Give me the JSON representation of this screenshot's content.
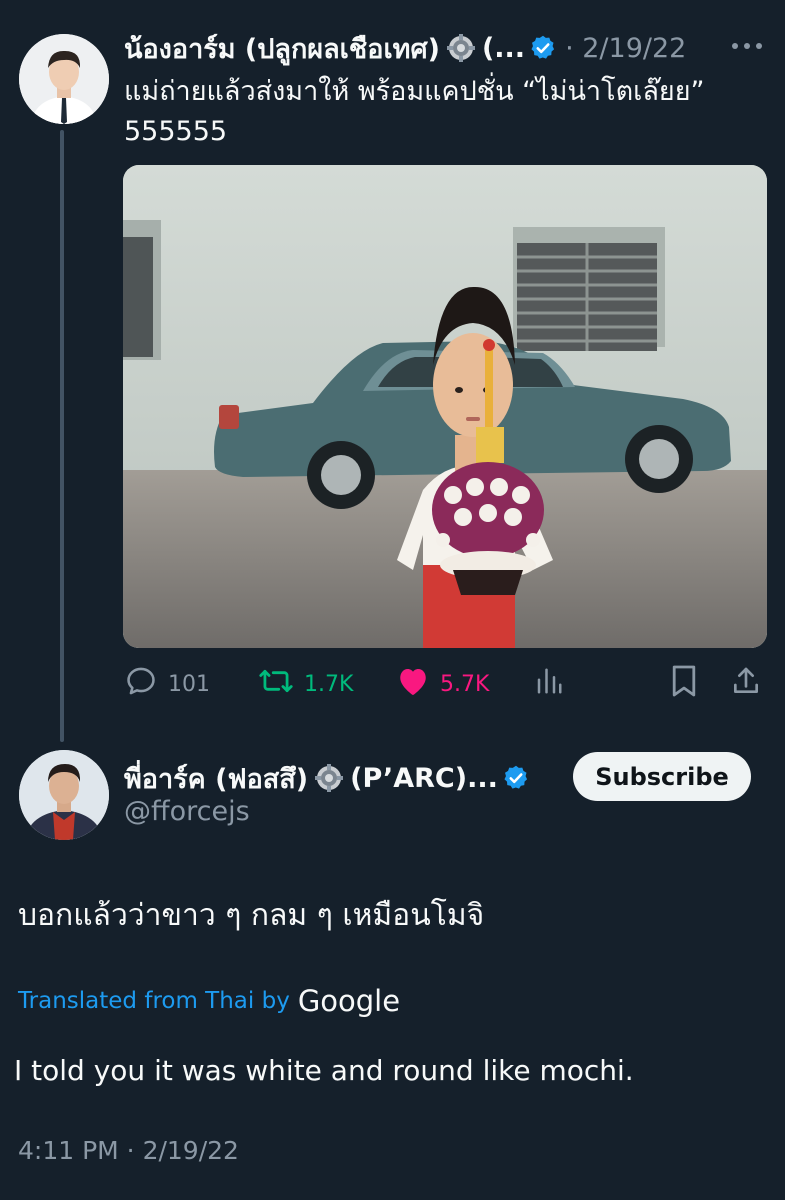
{
  "tweet1": {
    "author_name": "น้องอาร์ม (ปลูกผลเชือเทศ)",
    "name_truncation": "(...",
    "date": "· 2/19/22",
    "text_line1": "แม่ถ่ายแล้วส่งมาให้ พร้อมแคปชั่น “ไม่น่าโตเล๊ยย”",
    "text_line2": "555555",
    "stats": {
      "replies": "101",
      "retweets": "1.7K",
      "likes": "5.7K"
    }
  },
  "tweet2": {
    "author_name": "พี่อาร์ค (ฟอสสึ)",
    "name_suffix": "(P’ARC)...",
    "handle": "@fforcejs",
    "subscribe_label": "Subscribe",
    "text": "บอกแล้วว่าขาว ๆ กลม ๆ เหมือนโมจิ",
    "translated_label": "Translated from Thai by",
    "translator_brand": "Google",
    "translation": "I told you it was white and round like mochi.",
    "timestamp": "4:11 PM · 2/19/22"
  },
  "colors": {
    "background": "#15202b",
    "accent_blue": "#1d9bf0",
    "retweet_green": "#00ba7c",
    "like_pink": "#f91880",
    "secondary_text": "#8b98a5"
  },
  "icons": [
    "avatar",
    "gear-badge-icon",
    "verified-badge-icon",
    "more-icon",
    "reply-icon",
    "retweet-icon",
    "heart-icon",
    "views-icon",
    "bookmark-icon",
    "share-icon"
  ]
}
